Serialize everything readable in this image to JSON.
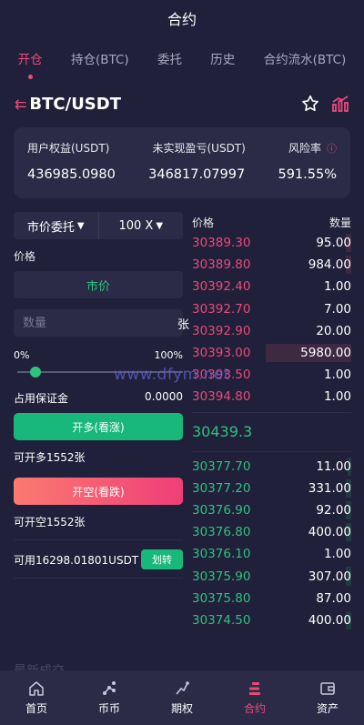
{
  "header": {
    "title": "合约"
  },
  "tabs": [
    {
      "label": "开仓",
      "active": true
    },
    {
      "label": "持仓(BTC)"
    },
    {
      "label": "委托"
    },
    {
      "label": "历史"
    },
    {
      "label": "合约流水(BTC)"
    }
  ],
  "pair": {
    "name": "BTC/USDT",
    "menu_icon": "list-icon",
    "favorite_icon": "star-icon",
    "chart_icon": "bar-chart-icon"
  },
  "equity": {
    "user_equity_label": "用户权益(USDT)",
    "user_equity_value": "436985.0980",
    "unrealized_pnl_label": "未实现盈亏(USDT)",
    "unrealized_pnl_value": "346817.07997",
    "risk_label": "风险率",
    "risk_value": "591.55%"
  },
  "order_form": {
    "order_type": "市价委托",
    "leverage": "100 X",
    "price_label": "价格",
    "price_value": "市价",
    "quantity_placeholder": "数量",
    "quantity_unit": "张",
    "slider_min": "0%",
    "slider_max": "100%",
    "slider_value": 0,
    "margin_label": "占用保证金",
    "margin_value": "0.0000",
    "long_button": "开多(看涨)",
    "long_available": "可开多1552张",
    "short_button": "开空(看跌)",
    "short_available": "可开空1552张",
    "balance": "可用16298.01801USDT",
    "transfer_button": "划转"
  },
  "orderbook": {
    "price_header": "价格",
    "qty_header": "数量",
    "asks": [
      {
        "price": "30389.30",
        "qty": "95.00",
        "depth": 0.03
      },
      {
        "price": "30389.80",
        "qty": "984.00",
        "depth": 0.03
      },
      {
        "price": "30392.40",
        "qty": "1.00",
        "depth": 0
      },
      {
        "price": "30392.70",
        "qty": "7.00",
        "depth": 0
      },
      {
        "price": "30392.90",
        "qty": "20.00",
        "depth": 0
      },
      {
        "price": "30393.00",
        "qty": "5980.00",
        "depth": 0.5
      },
      {
        "price": "30393.50",
        "qty": "1.00",
        "depth": 0
      },
      {
        "price": "30394.80",
        "qty": "1.00",
        "depth": 0
      }
    ],
    "last_price": "30439.3",
    "bids": [
      {
        "price": "30377.70",
        "qty": "11.00",
        "depth": 0.02
      },
      {
        "price": "30377.20",
        "qty": "331.00",
        "depth": 0.03
      },
      {
        "price": "30376.90",
        "qty": "92.00",
        "depth": 0.03
      },
      {
        "price": "30376.80",
        "qty": "400.00",
        "depth": 0.03
      },
      {
        "price": "30376.10",
        "qty": "1.00",
        "depth": 0
      },
      {
        "price": "30375.90",
        "qty": "307.00",
        "depth": 0.03
      },
      {
        "price": "30375.80",
        "qty": "87.00",
        "depth": 0
      },
      {
        "price": "30374.50",
        "qty": "400.00",
        "depth": 0.03
      }
    ]
  },
  "watermark": "www.dfym.net",
  "recent_trades_label": "最新成交",
  "bottom_nav": [
    {
      "label": "首页",
      "icon": "home-icon"
    },
    {
      "label": "币币",
      "icon": "coin-icon"
    },
    {
      "label": "期权",
      "icon": "option-icon"
    },
    {
      "label": "合约",
      "icon": "contract-icon",
      "active": true
    },
    {
      "label": "资产",
      "icon": "wallet-icon"
    }
  ],
  "colors": {
    "bg": "#21203a",
    "card": "#2c2b47",
    "accent": "#e94a7a",
    "up": "#2ec27e",
    "down": "#e94a7a"
  }
}
